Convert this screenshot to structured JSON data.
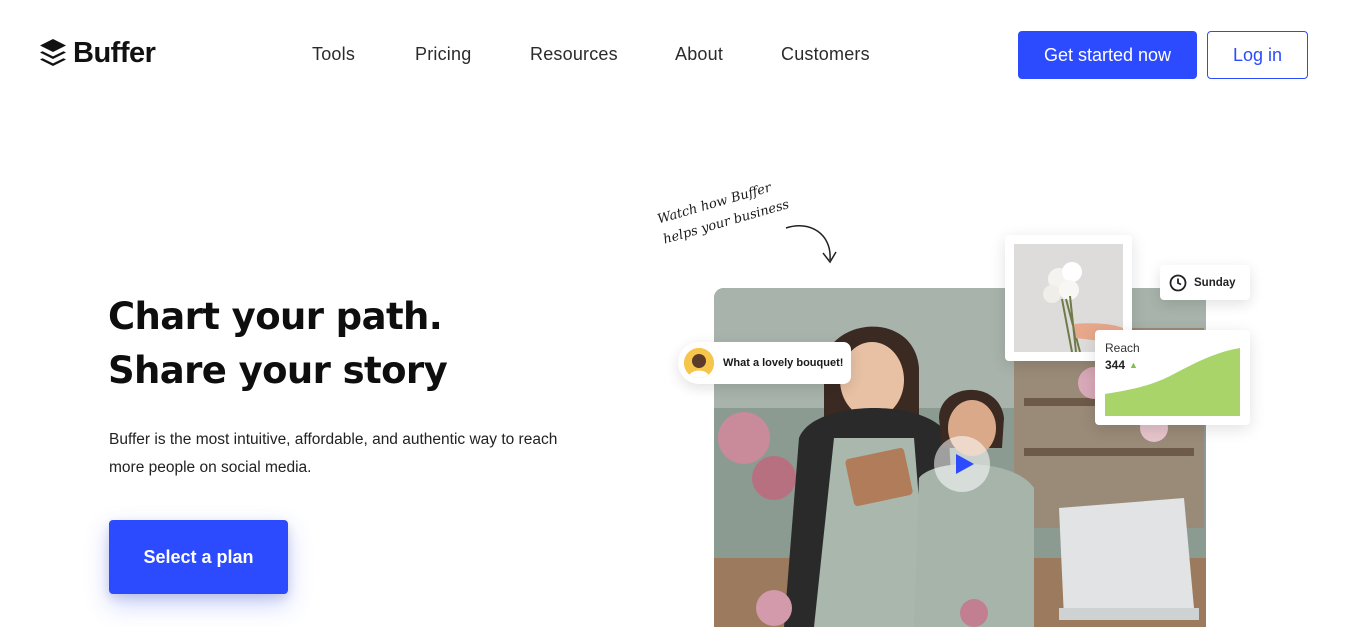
{
  "header": {
    "logo_text": "Buffer",
    "nav": [
      {
        "label": "Tools"
      },
      {
        "label": "Pricing"
      },
      {
        "label": "Resources"
      },
      {
        "label": "About"
      },
      {
        "label": "Customers"
      }
    ],
    "cta_label": "Get started now",
    "login_label": "Log in"
  },
  "hero": {
    "title_line1": "Chart your path.",
    "title_line2": "Share your story",
    "subtitle": "Buffer is the most intuitive, affordable, and authentic way to reach more people on social media.",
    "select_plan_label": "Select a plan"
  },
  "visual": {
    "handwritten_line1": "Watch how Buffer",
    "handwritten_line2": "helps your business",
    "comment_text": "What a lovely bouquet!",
    "schedule_day": "Sunday",
    "reach_label": "Reach",
    "reach_value": "344",
    "icons": [
      "buffer-logo-icon",
      "play-icon",
      "clock-icon",
      "arrow-up-icon",
      "curved-arrow-icon"
    ]
  },
  "colors": {
    "brand_blue": "#2c4bff",
    "reach_green": "#a8d46a",
    "text_dark": "#0e0e0e"
  }
}
